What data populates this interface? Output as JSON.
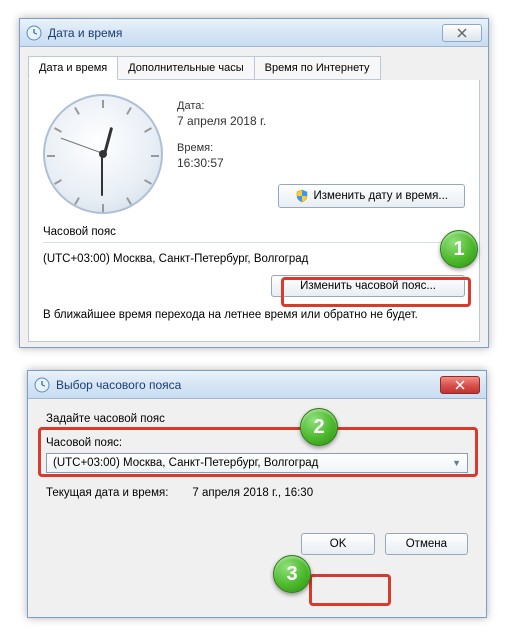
{
  "window1": {
    "title": "Дата и время",
    "tabs": [
      "Дата и время",
      "Дополнительные часы",
      "Время по Интернету"
    ],
    "date_label": "Дата:",
    "date_value": "7 апреля 2018 г.",
    "time_label": "Время:",
    "time_value": "16:30:57",
    "change_dt_btn": "Изменить дату и время...",
    "tz_heading": "Часовой пояс",
    "tz_value": "(UTC+03:00) Москва, Санкт-Петербург, Волгоград",
    "change_tz_btn": "Изменить часовой пояс...",
    "dst_note": "В ближайшее время перехода на летнее время или обратно не будет."
  },
  "window2": {
    "title": "Выбор часового пояса",
    "instruction": "Задайте часовой пояс",
    "tz_label": "Часовой пояс:",
    "tz_selected": "(UTC+03:00) Москва, Санкт-Петербург, Волгоград",
    "current_label": "Текущая дата и время:",
    "current_value": "7 апреля 2018 г., 16:30",
    "ok": "OK",
    "cancel": "Отмена"
  },
  "markers": {
    "m1": "1",
    "m2": "2",
    "m3": "3"
  }
}
